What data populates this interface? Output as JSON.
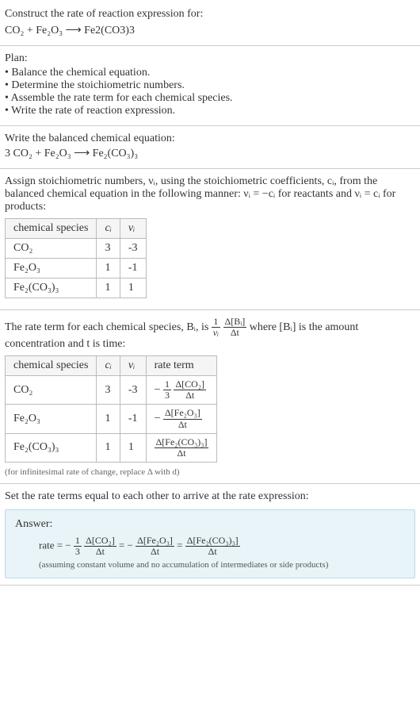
{
  "intro": {
    "prompt": "Construct the rate of reaction expression for:",
    "equation": "CO₂ + Fe₂O₃  ⟶  Fe2(CO3)3"
  },
  "plan": {
    "heading": "Plan:",
    "items": [
      "Balance the chemical equation.",
      "Determine the stoichiometric numbers.",
      "Assemble the rate term for each chemical species.",
      "Write the rate of reaction expression."
    ]
  },
  "balanced": {
    "heading": "Write the balanced chemical equation:",
    "equation": "3 CO₂ + Fe₂O₃  ⟶  Fe₂(CO₃)₃"
  },
  "stoich": {
    "text1": "Assign stoichiometric numbers, νᵢ, using the stoichiometric coefficients, cᵢ, from the balanced chemical equation in the following manner: νᵢ = −cᵢ for reactants and νᵢ = cᵢ for products:",
    "headers": [
      "chemical species",
      "cᵢ",
      "νᵢ"
    ],
    "rows": [
      {
        "species": "CO₂",
        "c": "3",
        "v": "-3"
      },
      {
        "species": "Fe₂O₃",
        "c": "1",
        "v": "-1"
      },
      {
        "species": "Fe₂(CO₃)₃",
        "c": "1",
        "v": "1"
      }
    ]
  },
  "rate_terms": {
    "text_before": "The rate term for each chemical species, Bᵢ, is ",
    "text_after": " where [Bᵢ] is the amount concentration and t is time:",
    "headers": [
      "chemical species",
      "cᵢ",
      "νᵢ",
      "rate term"
    ],
    "rows": [
      {
        "species": "CO₂",
        "c": "3",
        "v": "-3",
        "rt_prefix": "−",
        "rt_coef_num": "1",
        "rt_coef_den": "3",
        "rt_num": "Δ[CO₂]",
        "rt_den": "Δt"
      },
      {
        "species": "Fe₂O₃",
        "c": "1",
        "v": "-1",
        "rt_prefix": "−",
        "rt_coef_num": "",
        "rt_coef_den": "",
        "rt_num": "Δ[Fe₂O₃]",
        "rt_den": "Δt"
      },
      {
        "species": "Fe₂(CO₃)₃",
        "c": "1",
        "v": "1",
        "rt_prefix": "",
        "rt_coef_num": "",
        "rt_coef_den": "",
        "rt_num": "Δ[Fe₂(CO₃)₃]",
        "rt_den": "Δt"
      }
    ],
    "note": "(for infinitesimal rate of change, replace Δ with d)"
  },
  "final": {
    "heading": "Set the rate terms equal to each other to arrive at the rate expression:",
    "answer_label": "Answer:",
    "rate_label": "rate = −",
    "term1_coef_num": "1",
    "term1_coef_den": "3",
    "term1_num": "Δ[CO₂]",
    "term1_den": "Δt",
    "eq1": " = −",
    "term2_num": "Δ[Fe₂O₃]",
    "term2_den": "Δt",
    "eq2": " = ",
    "term3_num": "Δ[Fe₂(CO₃)₃]",
    "term3_den": "Δt",
    "note": "(assuming constant volume and no accumulation of intermediates or side products)"
  },
  "generic_frac": {
    "num": "1",
    "den": "νᵢ"
  },
  "generic_frac2": {
    "num": "Δ[Bᵢ]",
    "den": "Δt"
  }
}
